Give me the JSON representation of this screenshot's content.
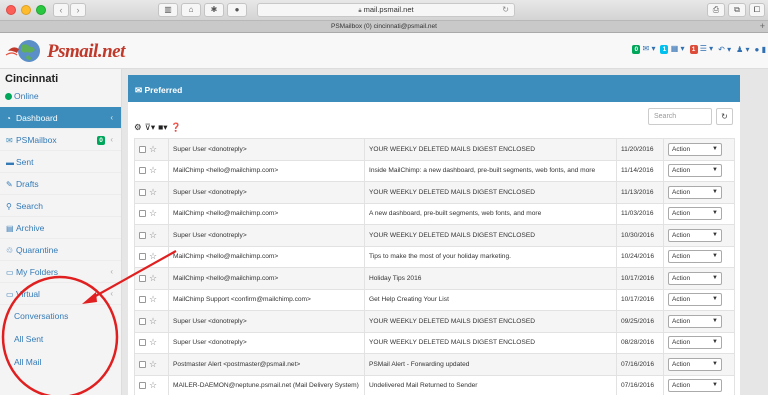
{
  "browser": {
    "url": "mail.psmail.net",
    "tab_title": "PSMailbox (0) cincinnati@psmail.net"
  },
  "app": {
    "logo_text": "Psmail.net",
    "header_badges": {
      "mail": "0",
      "calendar": "1",
      "tasks": "1"
    }
  },
  "sidebar": {
    "user_name": "Cincinnati",
    "status": "Online",
    "items": [
      {
        "label": "Dashboard",
        "icon": "dashboard-icon"
      },
      {
        "label": "PSMailbox",
        "badge": "0",
        "icon": "envelope-icon"
      },
      {
        "label": "Sent",
        "icon": "folder-icon"
      },
      {
        "label": "Drafts",
        "icon": "pencil-icon"
      },
      {
        "label": "Search",
        "icon": "search-icon"
      },
      {
        "label": "Archive",
        "icon": "archive-icon"
      },
      {
        "label": "Quarantine",
        "icon": "trash-icon"
      },
      {
        "label": "My Folders",
        "icon": "folder-open-icon"
      },
      {
        "label": "Virtual",
        "icon": "folder-open-icon"
      }
    ],
    "subitems": [
      "Conversations",
      "All Sent",
      "All Mail"
    ]
  },
  "main": {
    "box_title": "Preferred",
    "search_placeholder": "Search",
    "action_label": "Action",
    "rows": [
      {
        "from": "Super User <donotreply>",
        "subject": "YOUR WEEKLY DELETED MAILS DIGEST ENCLOSED",
        "date": "11/20/2016"
      },
      {
        "from": "MailChimp <hello@mailchimp.com>",
        "subject": "Inside MailChimp: a new dashboard, pre-built segments, web fonts, and more",
        "date": "11/14/2016"
      },
      {
        "from": "Super User <donotreply>",
        "subject": "YOUR WEEKLY DELETED MAILS DIGEST ENCLOSED",
        "date": "11/13/2016"
      },
      {
        "from": "MailChimp <hello@mailchimp.com>",
        "subject": "A new dashboard, pre-built segments, web fonts, and more",
        "date": "11/03/2016"
      },
      {
        "from": "Super User <donotreply>",
        "subject": "YOUR WEEKLY DELETED MAILS DIGEST ENCLOSED",
        "date": "10/30/2016"
      },
      {
        "from": "MailChimp <hello@mailchimp.com>",
        "subject": "Tips to make the most of your holiday marketing.",
        "date": "10/24/2016"
      },
      {
        "from": "MailChimp <hello@mailchimp.com>",
        "subject": "Holiday Tips 2016",
        "date": "10/17/2016"
      },
      {
        "from": "MailChimp Support <confirm@mailchimp.com>",
        "subject": "Get Help Creating Your List",
        "date": "10/17/2016"
      },
      {
        "from": "Super User <donotreply>",
        "subject": "YOUR WEEKLY DELETED MAILS DIGEST ENCLOSED",
        "date": "09/25/2016"
      },
      {
        "from": "Super User <donotreply>",
        "subject": "YOUR WEEKLY DELETED MAILS DIGEST ENCLOSED",
        "date": "08/28/2016"
      },
      {
        "from": "Postmaster Alert <postmaster@psmail.net>",
        "subject": "PSMail Alert - Forwarding updated",
        "date": "07/16/2016"
      },
      {
        "from": "MAILER-DAEMON@neptune.psmail.net (Mail Delivery System)",
        "subject": "Undelivered Mail Returned to Sender",
        "date": "07/16/2016"
      }
    ]
  },
  "colors": {
    "accent": "#3c8dbc",
    "annotation": "#e02020",
    "online": "#00a65a"
  }
}
